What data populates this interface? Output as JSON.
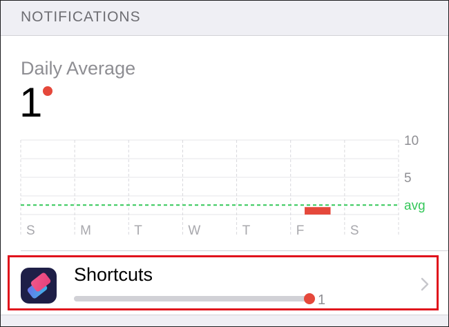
{
  "section": {
    "title": "NOTIFICATIONS"
  },
  "summary": {
    "label": "Daily Average",
    "value": "1"
  },
  "colors": {
    "accent_red": "#e5483b",
    "avg_green": "#34c759",
    "highlight_red": "#e0101b"
  },
  "chart_data": {
    "type": "bar",
    "categories": [
      "S",
      "M",
      "T",
      "W",
      "T",
      "F",
      "S"
    ],
    "values": [
      0,
      0,
      0,
      0,
      0,
      1,
      0
    ],
    "ylim": [
      0,
      10
    ],
    "yticks": [
      "10",
      "5"
    ],
    "average_label": "avg",
    "average_value": 1,
    "grid": true
  },
  "apps": [
    {
      "name": "Shortcuts",
      "count": "1",
      "fraction": 1.0,
      "icon": "shortcuts-app-icon"
    }
  ],
  "icons": {
    "chevron": "chevron-right-icon"
  }
}
